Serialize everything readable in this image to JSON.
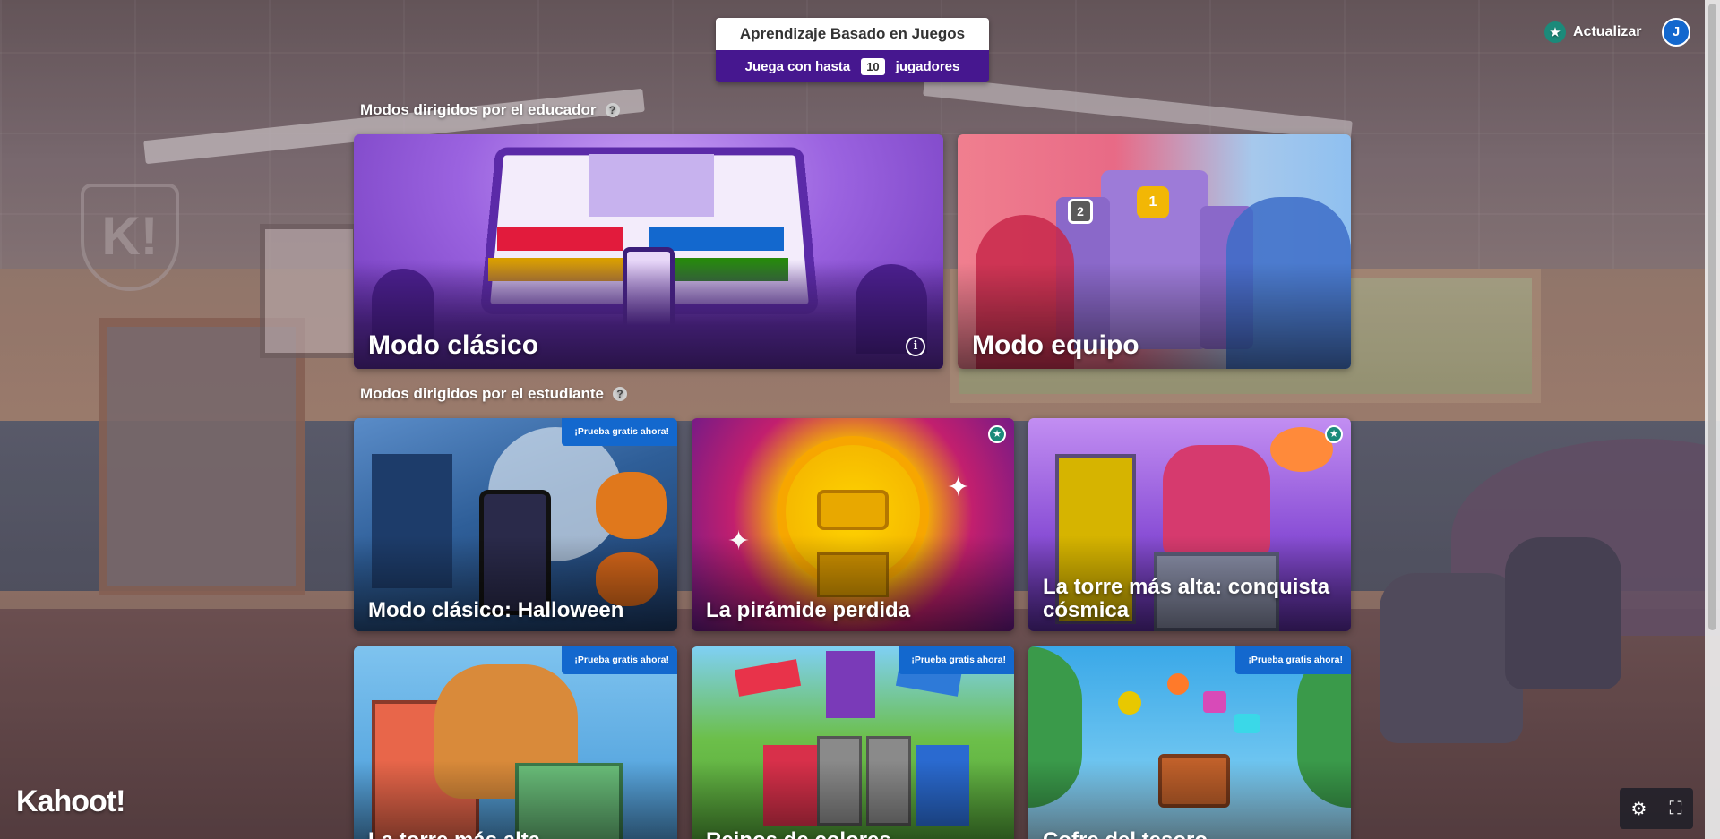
{
  "header": {
    "title": "Aprendizaje Basado en Juegos",
    "players_prefix": "Juega con hasta",
    "players_count": "10",
    "players_suffix": "jugadores",
    "upgrade_label": "Actualizar",
    "avatar_initial": "J"
  },
  "teacher_section": {
    "title": "Modos dirigidos por el educador",
    "help_icon": "?",
    "cards": [
      {
        "label": "Modo clásico",
        "icon": "info-icon"
      },
      {
        "label": "Modo equipo"
      }
    ]
  },
  "student_section": {
    "title": "Modos dirigidos por el estudiante",
    "help_icon": "?",
    "cards": [
      {
        "label": "Modo clásico: Halloween",
        "badge": "¡Prueba gratis ahora!"
      },
      {
        "label": "La pirámide perdida",
        "badge_icon": "star-icon"
      },
      {
        "label": "La torre más alta: conquista cósmica",
        "badge_icon": "star-icon"
      },
      {
        "label": "La torre más alta",
        "badge": "¡Prueba gratis ahora!"
      },
      {
        "label": "Reinos de colores",
        "badge": "¡Prueba gratis ahora!"
      },
      {
        "label": "Cofre del tesoro",
        "badge": "¡Prueba gratis ahora!"
      }
    ]
  },
  "footer": {
    "logo_text": "Kahoot!",
    "settings_icon": "gear-icon",
    "fullscreen_icon": "fullscreen-icon"
  },
  "colors": {
    "brand_purple": "#46178f",
    "ribbon_blue": "#1368ce",
    "premium_teal": "#1b8a7a"
  }
}
